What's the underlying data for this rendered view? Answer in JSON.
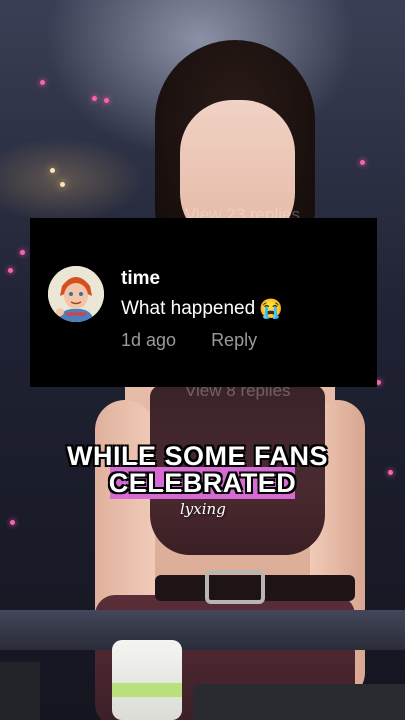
{
  "comment": {
    "view_replies_top": "View 23 replies",
    "view_replies_bottom": "View 8 replies",
    "username": "time",
    "text": "What happened",
    "emoji": "😭",
    "timestamp": "1d ago",
    "reply_label": "Reply",
    "avatar_icon": "chucky-doll-avatar"
  },
  "caption": {
    "line1": "WHILE SOME FANS",
    "line2": "CELEBRATED",
    "highlight_color": "#d66bd4"
  },
  "watermark": "lyxing"
}
